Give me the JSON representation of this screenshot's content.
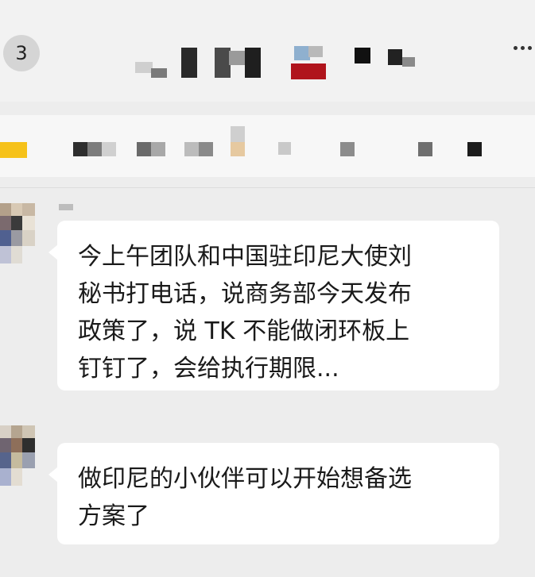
{
  "header": {
    "unread_count": "3",
    "title": ""
  },
  "messages": [
    {
      "lines": [
        "今上午团队和中国驻印尼大使刘",
        "秘书打电话，说商务部今天发布",
        "政策了，说 TK 不能做闭环板上",
        "钉钉了，会给执行期限..."
      ]
    },
    {
      "lines": [
        "做印尼的小伙伴可以开始想备选",
        "方案了"
      ]
    }
  ],
  "colors": {
    "background": "#ededed",
    "bubble": "#ffffff",
    "text": "#1a1a1a",
    "header": "#f2f2f2"
  }
}
